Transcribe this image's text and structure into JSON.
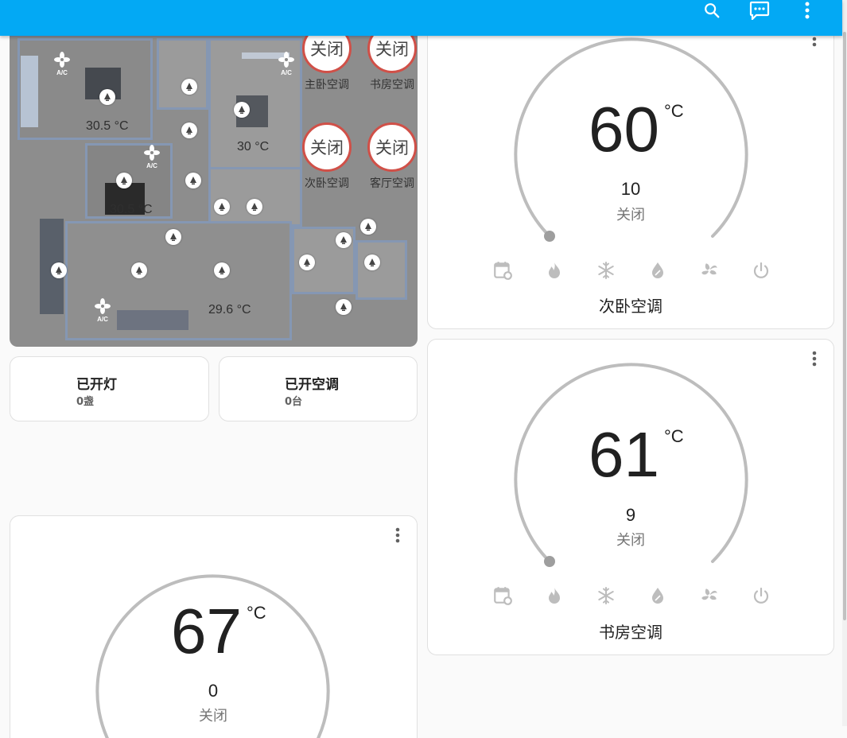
{
  "colors": {
    "header": "#03a9f4",
    "dial_track": "#bdbdbd",
    "status_ring": "#d05048"
  },
  "header": {
    "icons": [
      "search-icon",
      "chat-icon",
      "more-vertical-icon"
    ]
  },
  "floorplan": {
    "temps": [
      "30.5 °C",
      "30 °C",
      "30.5 °C",
      "29.6 °C"
    ],
    "ac_label": "A/C",
    "statuses": [
      {
        "state": "关闭",
        "name": "主卧空调"
      },
      {
        "state": "关闭",
        "name": "书房空调"
      },
      {
        "state": "关闭",
        "name": "次卧空调"
      },
      {
        "state": "关闭",
        "name": "客厅空调"
      }
    ]
  },
  "stats": [
    {
      "title": "已开灯",
      "value": "0盏"
    },
    {
      "title": "已开空调",
      "value": "0台"
    }
  ],
  "thermostats": [
    {
      "name": "次卧空调",
      "target": "60",
      "unit": "°C",
      "current": "10",
      "state": "关闭"
    },
    {
      "name": "书房空调",
      "target": "61",
      "unit": "°C",
      "current": "9",
      "state": "关闭"
    },
    {
      "name": "",
      "target": "67",
      "unit": "°C",
      "current": "0",
      "state": "关闭"
    }
  ],
  "modes": [
    "schedule-icon",
    "heat-icon",
    "cool-icon",
    "dry-icon",
    "fan-icon",
    "power-icon"
  ]
}
